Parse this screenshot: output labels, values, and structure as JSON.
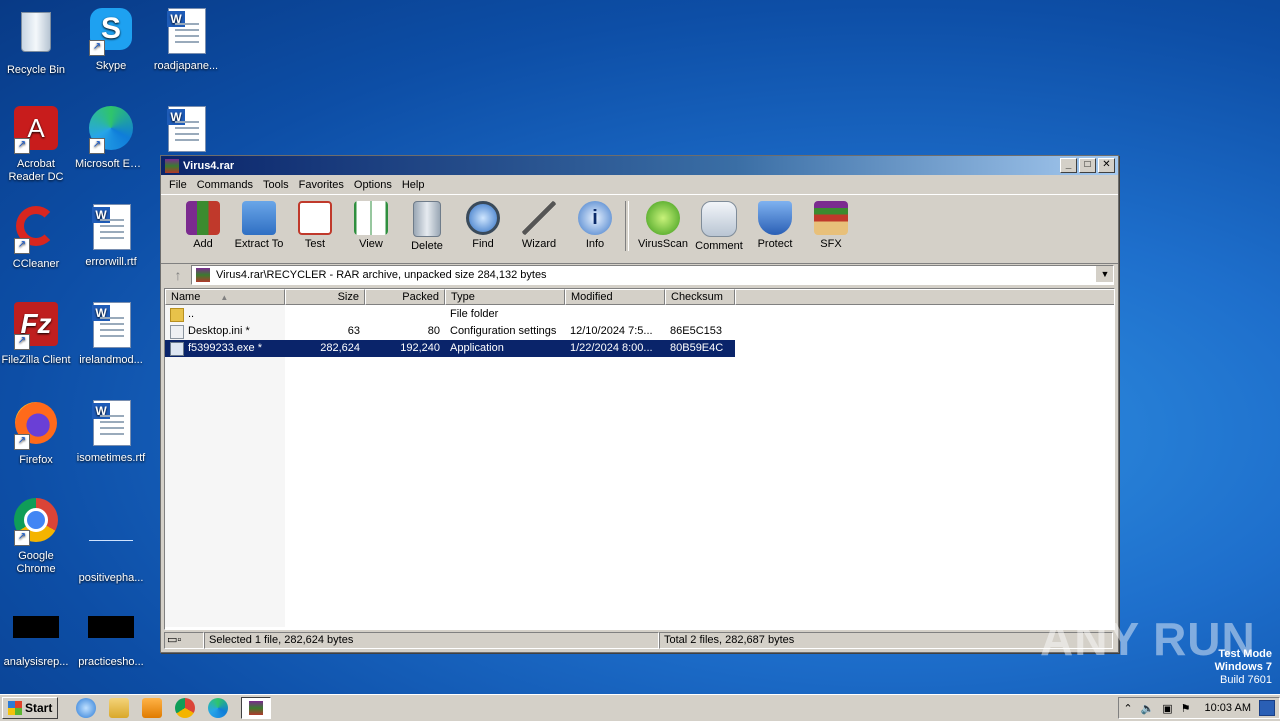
{
  "desktop": {
    "icons": [
      {
        "label": "Recycle Bin"
      },
      {
        "label": "Skype"
      },
      {
        "label": "roadjapane..."
      },
      {
        "label": "Acrobat Reader DC"
      },
      {
        "label": "Microsoft Edge"
      },
      {
        "label": "CCleaner"
      },
      {
        "label": "errorwill.rtf"
      },
      {
        "label": "FileZilla Client"
      },
      {
        "label": "irelandmod..."
      },
      {
        "label": "Firefox"
      },
      {
        "label": "isometimes.rtf"
      },
      {
        "label": "Google Chrome"
      },
      {
        "label": "positivepha..."
      },
      {
        "label": "analysisrep..."
      },
      {
        "label": "practicesho..."
      }
    ]
  },
  "window": {
    "title": "Virus4.rar",
    "menu": [
      "File",
      "Commands",
      "Tools",
      "Favorites",
      "Options",
      "Help"
    ],
    "toolbar": [
      "Add",
      "Extract To",
      "Test",
      "View",
      "Delete",
      "Find",
      "Wizard",
      "Info",
      "VirusScan",
      "Comment",
      "Protect",
      "SFX"
    ],
    "address": "Virus4.rar\\RECYCLER - RAR archive, unpacked size 284,132 bytes",
    "columns": [
      "Name",
      "Size",
      "Packed",
      "Type",
      "Modified",
      "Checksum"
    ],
    "rows": [
      {
        "name": "..",
        "size": "",
        "packed": "",
        "type": "File folder",
        "modified": "",
        "checksum": ""
      },
      {
        "name": "Desktop.ini *",
        "size": "63",
        "packed": "80",
        "type": "Configuration settings",
        "modified": "12/10/2024 7:5...",
        "checksum": "86E5C153"
      },
      {
        "name": "f5399233.exe *",
        "size": "282,624",
        "packed": "192,240",
        "type": "Application",
        "modified": "1/22/2024 8:00...",
        "checksum": "80B59E4C"
      }
    ],
    "status_left": "Selected 1 file, 282,624 bytes",
    "status_right": "Total 2 files, 282,687 bytes"
  },
  "taskbar": {
    "start_label": "Start",
    "clock": "10:03 AM"
  },
  "watermark": {
    "line1": "Test Mode",
    "line2": "Windows 7",
    "line3": "Build 7601",
    "brand": "ANY RUN"
  },
  "colors": {
    "selection": "#0a246a",
    "titlebar": "#0a246a",
    "desktop": "#1e6fcc"
  }
}
